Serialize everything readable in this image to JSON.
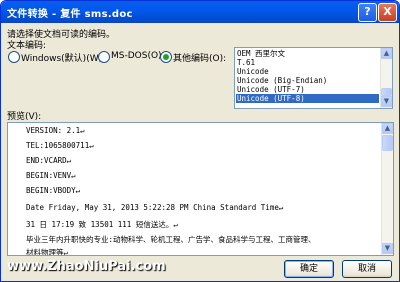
{
  "window": {
    "title": "文件转换 - 复件 sms.doc"
  },
  "titlebar_buttons": {
    "help": "?",
    "close": "X"
  },
  "instruction": "请选择使文档可读的编码。",
  "encoding_label": "文本编码:",
  "radios": [
    {
      "label": "Windows(默认)(W)",
      "checked": false
    },
    {
      "label": "MS-DOS(O)",
      "checked": false
    },
    {
      "label": "其他编码(O):",
      "checked": true
    }
  ],
  "encodings": [
    {
      "label": "OEM 西里尔文",
      "selected": false
    },
    {
      "label": "T.61",
      "selected": false
    },
    {
      "label": "Unicode",
      "selected": false
    },
    {
      "label": "Unicode (Big-Endian)",
      "selected": false
    },
    {
      "label": "Unicode (UTF-7)",
      "selected": false
    },
    {
      "label": "Unicode (UTF-8)",
      "selected": true
    }
  ],
  "preview_label": "预览(V):",
  "preview_lines": [
    "VERSION: 2.1↵",
    "TEL:1065800711↵",
    "END:VCARD↵",
    "BEGIN:VENV↵",
    "BEGIN:VBODY↵",
    "Date Friday, May 31, 2013 5:22:28 PM China Standard Time↵",
    "31 日 17:19 致 13501    111 短信送达。↵",
    "毕业三年内升职快的专业:动物科学、轮机工程、广告学、食品科学与工程、工商管理、",
    "材料物理等↵"
  ],
  "buttons": {
    "ok": "确定",
    "cancel": "取消"
  },
  "watermark": "www.ZhaoNiuPai.com",
  "colors": {
    "titlebar": "#0058ee",
    "selection": "#316ac5",
    "radio_dot": "#21a121"
  }
}
